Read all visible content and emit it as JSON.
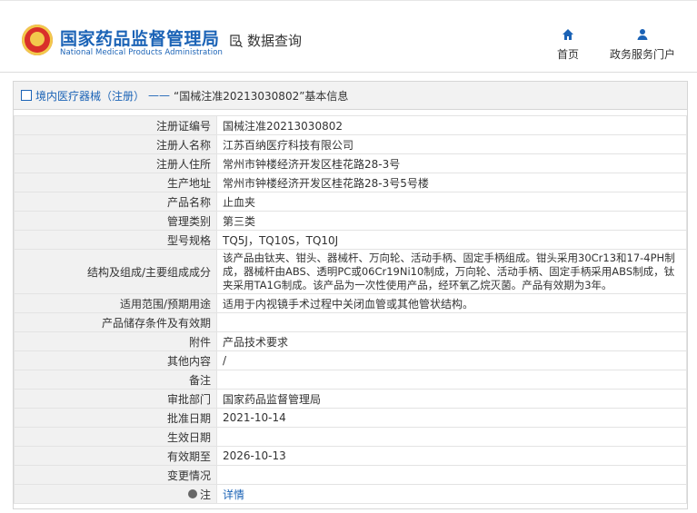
{
  "header": {
    "org_cn": "国家药品监督管理局",
    "org_en": "National Medical Products Administration",
    "search_label": "数据查询",
    "nav": [
      {
        "label": "首页",
        "icon": "home-icon"
      },
      {
        "label": "政务服务门户",
        "icon": "user-icon"
      }
    ]
  },
  "breadcrumb": {
    "main": "境内医疗器械（注册）",
    "sep": "——",
    "title": "“国械注准20213030802”基本信息"
  },
  "rows": [
    {
      "key": "注册证编号",
      "value": "国械注准20213030802"
    },
    {
      "key": "注册人名称",
      "value": "江苏百纳医疗科技有限公司"
    },
    {
      "key": "注册人住所",
      "value": "常州市钟楼经济开发区桂花路28-3号"
    },
    {
      "key": "生产地址",
      "value": "常州市钟楼经济开发区桂花路28-3号5号楼"
    },
    {
      "key": "产品名称",
      "value": "止血夹"
    },
    {
      "key": "管理类别",
      "value": "第三类"
    },
    {
      "key": "型号规格",
      "value": "TQ5J，TQ10S，TQ10J"
    },
    {
      "key": "结构及组成/主要组成成分",
      "value": "该产品由钛夹、钳头、器械杆、万向轮、活动手柄、固定手柄组成。钳头采用30Cr13和17-4PH制成，器械杆由ABS、透明PC或06Cr19Ni10制成，万向轮、活动手柄、固定手柄采用ABS制成，钛夹采用TA1G制成。该产品为一次性使用产品，经环氧乙烷灭菌。产品有效期为3年。"
    },
    {
      "key": "适用范围/预期用途",
      "value": "适用于内视镜手术过程中关闭血管或其他管状结构。"
    },
    {
      "key": "产品储存条件及有效期",
      "value": ""
    },
    {
      "key": "附件",
      "value": "产品技术要求"
    },
    {
      "key": "其他内容",
      "value": "/"
    },
    {
      "key": "备注",
      "value": ""
    },
    {
      "key": "审批部门",
      "value": "国家药品监督管理局"
    },
    {
      "key": "批准日期",
      "value": "2021-10-14"
    },
    {
      "key": "生效日期",
      "value": ""
    },
    {
      "key": "有效期至",
      "value": "2026-10-13"
    },
    {
      "key": "变更情况",
      "value": ""
    },
    {
      "key": "注",
      "value": "详情"
    }
  ]
}
